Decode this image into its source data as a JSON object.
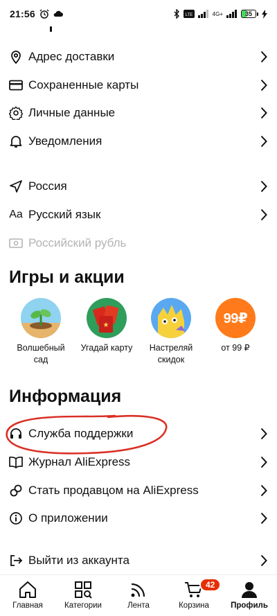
{
  "status_bar": {
    "time": "21:56",
    "network": "4G+",
    "battery": "35"
  },
  "settings_rows": [
    {
      "label": "Адрес доставки",
      "icon": "location-pin-icon"
    },
    {
      "label": "Сохраненные карты",
      "icon": "credit-card-icon"
    },
    {
      "label": "Личные данные",
      "icon": "gear-icon"
    },
    {
      "label": "Уведомления",
      "icon": "bell-icon"
    }
  ],
  "locale_rows": [
    {
      "label": "Россия",
      "icon": "navigation-arrow-icon"
    },
    {
      "label": "Русский язык",
      "icon": "font-size-icon",
      "icon_text": "Aa"
    },
    {
      "label": "Российский рубль",
      "icon": "banknote-icon",
      "disabled": true
    }
  ],
  "games": {
    "title": "Игры и акции",
    "items": [
      {
        "name": "Волшебный сад",
        "icon": "sprout-icon"
      },
      {
        "name": "Угадай карту",
        "icon": "red-cards-icon"
      },
      {
        "name": "Настреляй скидок",
        "icon": "monster-icon"
      },
      {
        "name": "от 99 ₽",
        "icon": "price-99-icon",
        "badge_text": "99₽"
      }
    ]
  },
  "info": {
    "title": "Информация",
    "rows": [
      {
        "label": "Служба поддержки",
        "icon": "headset-icon"
      },
      {
        "label": "Журнал AliExpress",
        "icon": "book-icon"
      },
      {
        "label": "Стать продавцом на AliExpress",
        "icon": "link-icon"
      },
      {
        "label": "О приложении",
        "icon": "info-icon"
      }
    ]
  },
  "logout": {
    "label": "Выйти из аккаунта",
    "icon": "logout-icon"
  },
  "bottom_nav": [
    {
      "label": "Главная",
      "icon": "home-icon"
    },
    {
      "label": "Категории",
      "icon": "categories-icon"
    },
    {
      "label": "Лента",
      "icon": "feed-icon"
    },
    {
      "label": "Корзина",
      "icon": "cart-icon",
      "badge": "42"
    },
    {
      "label": "Профиль",
      "icon": "profile-icon",
      "active": true
    }
  ],
  "colors": {
    "accent_red": "#e62e04",
    "annotation_red": "#d93025",
    "disabled_text": "#b3b3b3"
  }
}
